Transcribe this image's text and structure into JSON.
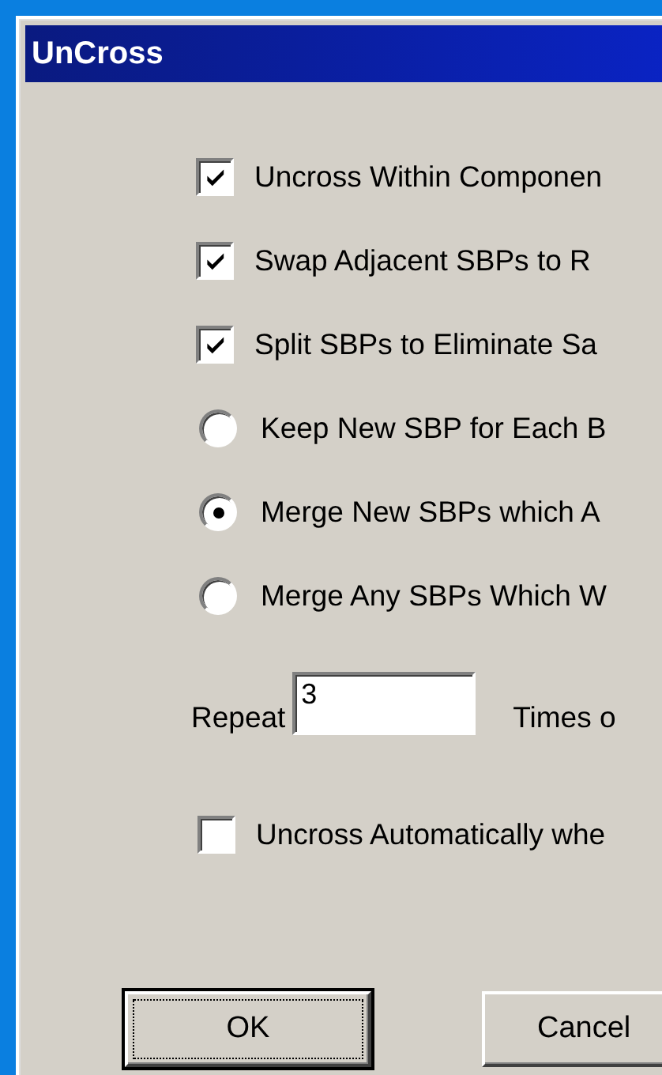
{
  "window": {
    "title": "UnCross"
  },
  "options": [
    {
      "kind": "checkbox",
      "label": "Uncross Within Componen",
      "checked": true
    },
    {
      "kind": "checkbox",
      "label": "Swap Adjacent SBPs to R",
      "checked": true
    },
    {
      "kind": "checkbox",
      "label": "Split SBPs to Eliminate Sa",
      "checked": true
    },
    {
      "kind": "radio",
      "label": "Keep New SBP for Each B",
      "selected": false
    },
    {
      "kind": "radio",
      "label": "Merge New SBPs which A",
      "selected": true
    },
    {
      "kind": "radio",
      "label": "Merge Any SBPs Which W",
      "selected": false
    }
  ],
  "repeat": {
    "label": "Repeat",
    "value": "3",
    "suffix": "Times o"
  },
  "auto_option": {
    "label": "Uncross Automatically whe",
    "checked": false
  },
  "buttons": [
    {
      "label": "OK",
      "default": true
    },
    {
      "label": "Cancel",
      "default": false
    }
  ]
}
